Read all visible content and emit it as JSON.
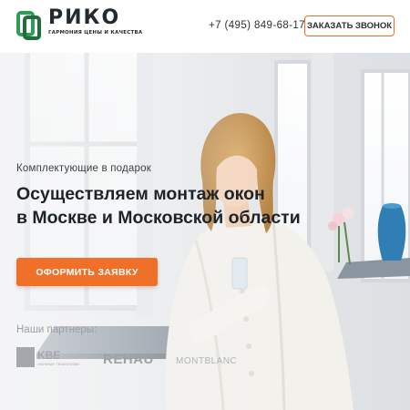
{
  "header": {
    "brand_name": "РИКО",
    "brand_tagline": "ГАРМОНИЯ ЦЕНЫ И КАЧЕСТВА",
    "phone": "+7 (495) 849-68-17",
    "callback_button": "ЗАКАЗАТЬ ЗВОНОК"
  },
  "hero": {
    "subtitle": "Комплектующие в подарок",
    "headline_line1": "Осуществляем монтаж окон",
    "headline_line2": "в Москве и Московской области",
    "cta_button": "ОФОРМИТЬ ЗАЯВКУ"
  },
  "partners": {
    "label": "Наши партнеры:",
    "items": [
      {
        "name": "KBE",
        "subtitle": "оконные технологии",
        "icon": "kbe-logo-icon"
      },
      {
        "name": "REHAU"
      },
      {
        "name": "MONTBLANC"
      }
    ]
  },
  "colors": {
    "accent": "#f0702a",
    "brand_green": "#2e9b57",
    "text_dark": "#1d2329"
  }
}
